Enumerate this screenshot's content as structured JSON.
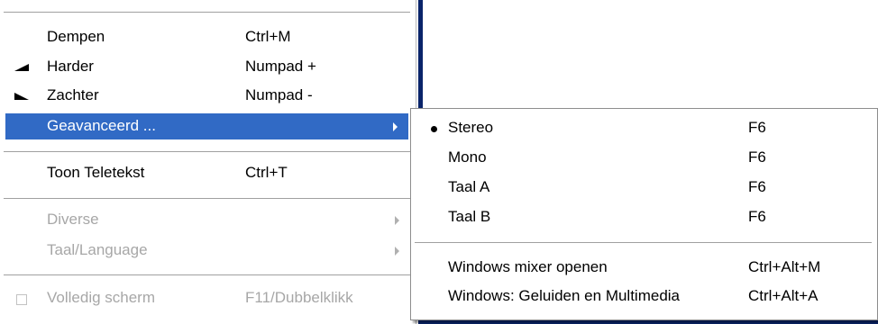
{
  "menu": {
    "items": [
      {
        "label": "Dempen",
        "shortcut": "Ctrl+M"
      },
      {
        "label": "Harder",
        "shortcut": "Numpad +",
        "icon": "volume-up-icon"
      },
      {
        "label": "Zachter",
        "shortcut": "Numpad -",
        "icon": "volume-down-icon"
      },
      {
        "label": "Geavanceerd ...",
        "shortcut": "",
        "highlighted": true,
        "has_submenu": true
      },
      {
        "label": "Toon Teletekst",
        "shortcut": "Ctrl+T"
      },
      {
        "label": "Diverse",
        "shortcut": "",
        "disabled": true,
        "has_submenu": true
      },
      {
        "label": "Taal/Language",
        "shortcut": "",
        "disabled": true,
        "has_submenu": true
      },
      {
        "label": "Volledig scherm",
        "shortcut": "F11/Dubbelklikk",
        "disabled": true,
        "icon": "checkbox-icon"
      }
    ]
  },
  "submenu": {
    "items": [
      {
        "label": "Stereo",
        "shortcut": "F6",
        "selected": true
      },
      {
        "label": "Mono",
        "shortcut": "F6"
      },
      {
        "label": "Taal A",
        "shortcut": "F6"
      },
      {
        "label": "Taal B",
        "shortcut": "F6"
      },
      {
        "label": "Windows mixer openen",
        "shortcut": "Ctrl+Alt+M"
      },
      {
        "label": "Windows: Geluiden en Multimedia",
        "shortcut": "Ctrl+Alt+A"
      }
    ]
  },
  "colors": {
    "highlight": "#316ac5",
    "window_edge": "#0a246a",
    "disabled_text": "#a7a7a7"
  }
}
